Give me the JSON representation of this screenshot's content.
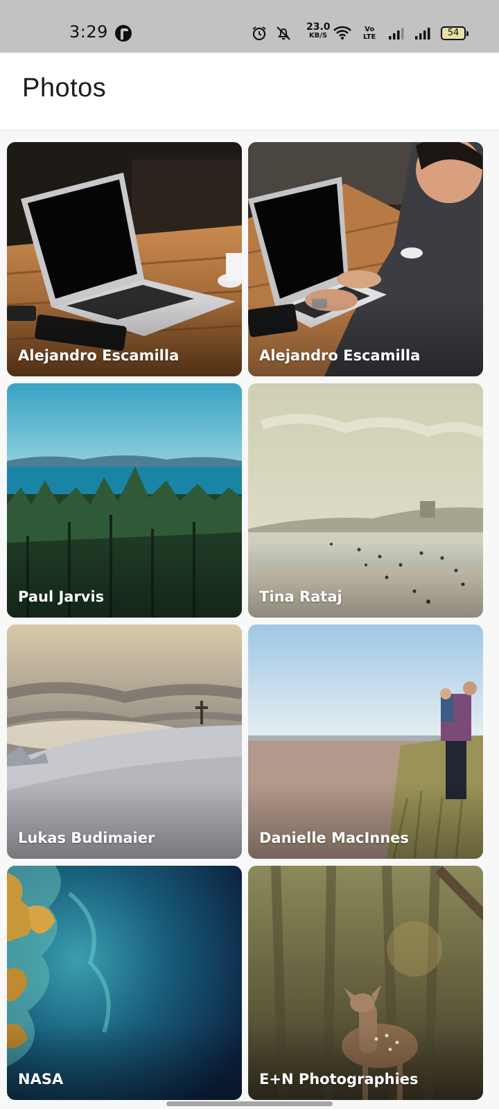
{
  "status_bar": {
    "time": "3:29",
    "network_speed": "23.0",
    "network_speed_unit": "KB/S",
    "volte_top": "Vo",
    "volte_bottom": "LTE",
    "battery": "54"
  },
  "app_bar": {
    "title": "Photos"
  },
  "photos": [
    {
      "author": "Alejandro Escamilla",
      "scene": "laptop-on-wooden-table"
    },
    {
      "author": "Alejandro Escamilla",
      "scene": "person-typing-on-laptop"
    },
    {
      "author": "Paul Jarvis",
      "scene": "forest-and-sea"
    },
    {
      "author": "Tina Rataj",
      "scene": "hazy-beach"
    },
    {
      "author": "Lukas Budimaier",
      "scene": "snowy-hill-with-cross"
    },
    {
      "author": "Danielle MacInnes",
      "scene": "father-and-child-on-beach"
    },
    {
      "author": "NASA",
      "scene": "satellite-earth-view"
    },
    {
      "author": "E+N Photographies",
      "scene": "deer-in-forest"
    }
  ]
}
